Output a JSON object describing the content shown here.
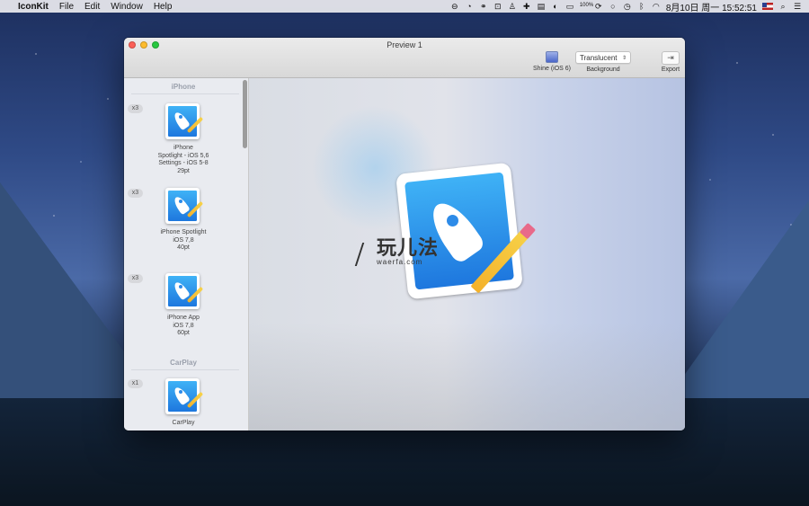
{
  "menubar": {
    "apple_icon": "",
    "app_name": "IconKit",
    "menus": [
      "File",
      "Edit",
      "Window",
      "Help"
    ],
    "battery_percent": "100%",
    "datetime": "8月10日 周一  15:52:51",
    "status_icons": [
      "stop-icon",
      "timer-icon",
      "link-icon",
      "screenshot-icon",
      "user-icon",
      "plus-icon",
      "document-icon",
      "toggle-icon",
      "battery-icon",
      "reload-icon",
      "circle-icon",
      "clock-icon",
      "bluetooth-icon",
      "wifi-icon",
      "flag-icon",
      "search-icon",
      "list-icon"
    ]
  },
  "window": {
    "title": "Preview 1",
    "toolbar": {
      "shine_label": "Shine (iOS 6)",
      "background_label": "Background",
      "background_value": "Translucent",
      "export_label": "Export"
    }
  },
  "sidebar": {
    "sections": [
      {
        "title": "iPhone",
        "items": [
          {
            "badge": "x3",
            "lines": [
              "iPhone",
              "Spotlight - iOS 5,6",
              "Settings - iOS 5-8",
              "29pt"
            ]
          },
          {
            "badge": "x3",
            "lines": [
              "iPhone Spotlight",
              "iOS 7,8",
              "40pt"
            ]
          },
          {
            "badge": "x3",
            "lines": [
              "iPhone App",
              "iOS 7,8",
              "60pt"
            ]
          }
        ]
      },
      {
        "title": "CarPlay",
        "items": [
          {
            "badge": "x1",
            "lines": [
              "CarPlay"
            ]
          }
        ]
      }
    ]
  },
  "watermark": {
    "cn": "玩儿法",
    "url": "waerfa.com"
  },
  "colors": {
    "icon_blue_top": "#3fb2f6",
    "icon_blue_bottom": "#1e77de",
    "close": "#fc5f57",
    "minimize": "#fdbc2e",
    "zoom": "#28c840"
  }
}
